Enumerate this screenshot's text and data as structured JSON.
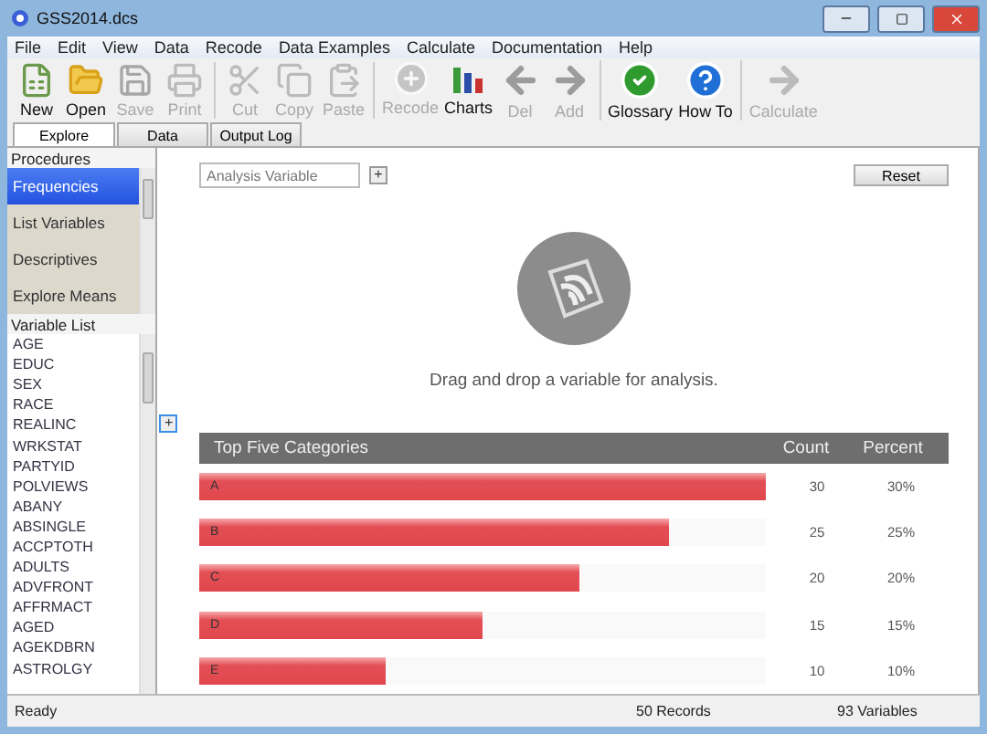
{
  "window": {
    "title": "GSS2014.dcs"
  },
  "menu": [
    "File",
    "Edit",
    "View",
    "Data",
    "Recode",
    "Data Examples",
    "Calculate",
    "Documentation",
    "Help"
  ],
  "toolbar": [
    [
      {
        "label": "New",
        "disabled": false
      },
      {
        "label": "Open",
        "disabled": false
      },
      {
        "label": "Save",
        "disabled": true
      },
      {
        "label": "Print",
        "disabled": true
      }
    ],
    [
      {
        "label": "Cut",
        "disabled": true
      },
      {
        "label": "Copy",
        "disabled": true
      },
      {
        "label": "Paste",
        "disabled": true
      }
    ],
    [
      {
        "label": "Recode",
        "disabled": true
      },
      {
        "label": "Charts",
        "disabled": false
      },
      {
        "label": "Del",
        "disabled": true
      },
      {
        "label": "Add",
        "disabled": true
      }
    ],
    [
      {
        "label": "Glossary",
        "disabled": false
      },
      {
        "label": "How To",
        "disabled": false
      }
    ],
    [
      {
        "label": "Calculate",
        "disabled": true
      }
    ]
  ],
  "tabs": [
    {
      "label": "Explore",
      "selected": true
    },
    {
      "label": "Data",
      "selected": false
    },
    {
      "label": "Output Log",
      "selected": false
    }
  ],
  "procedures": {
    "header": "Procedures",
    "items": [
      {
        "label": "Frequencies",
        "selected": true
      },
      {
        "label": "List Variables",
        "selected": false
      },
      {
        "label": "Descriptives",
        "selected": false
      },
      {
        "label": "Explore Means",
        "selected": false
      }
    ]
  },
  "variable_list": {
    "header": "Variable List",
    "items": [
      "AGE",
      "EDUC",
      "SEX",
      "RACE",
      "REALINC",
      "WRKSTAT",
      "PARTYID",
      "POLVIEWS",
      "ABANY",
      "ABSINGLE",
      "ACCPTOTH",
      "ADULTS",
      "ADVFRONT",
      "AFFRMACT",
      "AGED",
      "AGEKDBRN",
      "ASTROLGY"
    ]
  },
  "analysis": {
    "placeholder": "Analysis Variable",
    "add_button": "+",
    "reset_button": "Reset",
    "side_add_button": "+",
    "message": "Drag and drop a variable for analysis."
  },
  "top_categories": {
    "columns": [
      "Top Five Categories",
      "Count",
      "Percent"
    ],
    "rows": [
      {
        "label": "A",
        "level": 1.0,
        "count": "30",
        "percent": "30%"
      },
      {
        "label": "B",
        "level": 0.83,
        "count": "25",
        "percent": "25%"
      },
      {
        "label": "C",
        "level": 0.67,
        "count": "20",
        "percent": "20%"
      },
      {
        "label": "D",
        "level": 0.5,
        "count": "15",
        "percent": "15%"
      },
      {
        "label": "E",
        "level": 0.33,
        "count": "10",
        "percent": "10%"
      }
    ]
  },
  "status_bar": {
    "status": "Ready",
    "records": "50 Records",
    "variables": "93 Variables"
  }
}
